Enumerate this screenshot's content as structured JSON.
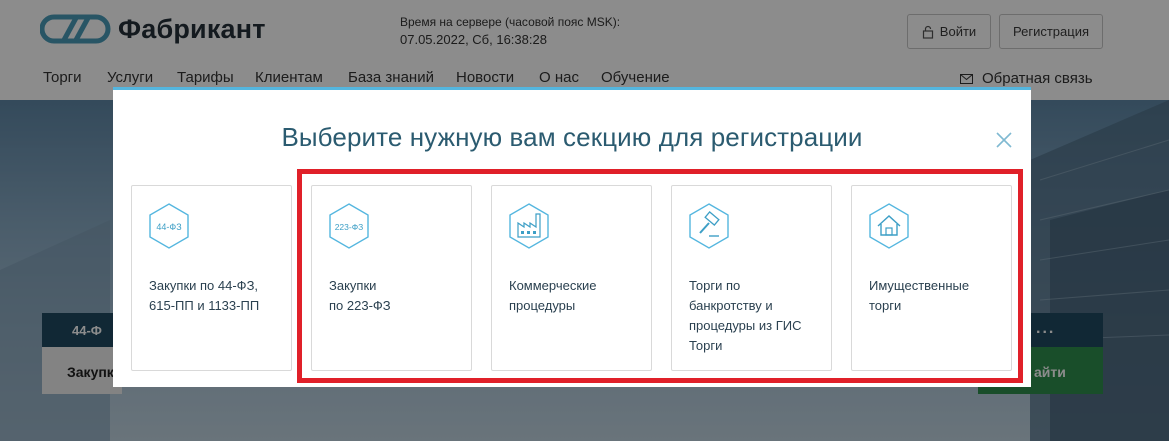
{
  "header": {
    "logo_text": "Фабрикант",
    "server_time_label": "Время на сервере (часовой пояс MSK):",
    "server_time_value": "07.05.2022, Сб, 16:38:28",
    "login_label": "Войти",
    "register_label": "Регистрация",
    "nav": [
      "Торги",
      "Услуги",
      "Тарифы",
      "Клиентам",
      "База знаний",
      "Новости",
      "О нас",
      "Обучение"
    ],
    "feedback_label": "Обратная связь"
  },
  "background": {
    "tab_label": "44-Ф",
    "row_label": "Закупк",
    "dots_label": "...",
    "green_label": "айти"
  },
  "modal": {
    "title": "Выберите нужную вам секцию для регистрации",
    "cards": [
      {
        "icon": "44-fz-icon",
        "icon_text": "44-ФЗ",
        "label": "Закупки по 44-ФЗ,\n615-ПП и 1133-ПП"
      },
      {
        "icon": "223-fz-icon",
        "icon_text": "223-ФЗ",
        "label": "Закупки\nпо 223-ФЗ"
      },
      {
        "icon": "factory-icon",
        "icon_text": "",
        "label": "Коммерческие\nпроцедуры"
      },
      {
        "icon": "gavel-icon",
        "icon_text": "",
        "label": "Торги по\nбанкротству и\nпроцедуры из ГИС\nТорги"
      },
      {
        "icon": "house-icon",
        "icon_text": "",
        "label": "Имущественные\nторги"
      }
    ]
  },
  "colors": {
    "accent": "#54b6df",
    "title": "#2b5b70",
    "highlight": "#e02029",
    "nav_dark": "#1f4a62",
    "green": "#2f8f4e"
  }
}
